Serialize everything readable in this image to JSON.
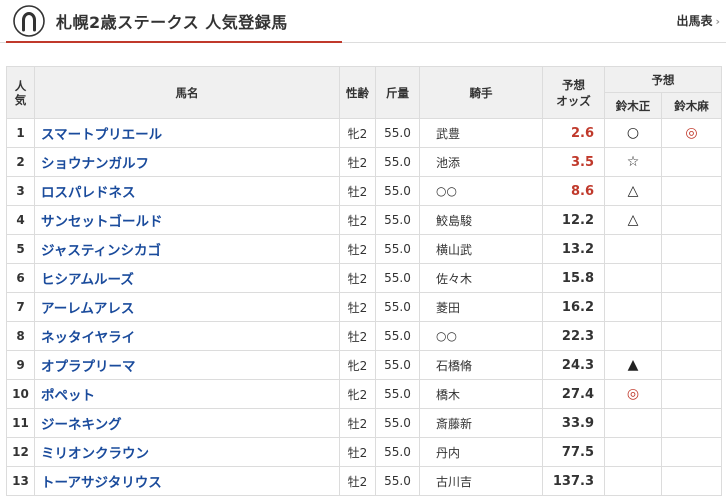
{
  "header": {
    "title": "札幌2歳ステークス 人気登録馬",
    "link_label": "出馬表",
    "link_chevron": "›"
  },
  "table": {
    "headers": {
      "rank_line1": "人",
      "rank_line2": "気",
      "horse": "馬名",
      "sexage": "性齢",
      "weight": "斤量",
      "jockey": "騎手",
      "odds_line1": "予想",
      "odds_line2": "オッズ",
      "prediction": "予想",
      "predictor1": "鈴木正",
      "predictor2": "鈴木麻"
    },
    "rows": [
      {
        "rank": "1",
        "horse": "スマートプリエール",
        "sexage": "牝2",
        "weight": "55.0",
        "jockey": "武豊",
        "odds": "2.6",
        "mark1": "○",
        "mark2": "◎"
      },
      {
        "rank": "2",
        "horse": "ショウナンガルフ",
        "sexage": "牡2",
        "weight": "55.0",
        "jockey": "池添",
        "odds": "3.5",
        "mark1": "☆",
        "mark2": ""
      },
      {
        "rank": "3",
        "horse": "ロスパレドネス",
        "sexage": "牡2",
        "weight": "55.0",
        "jockey": "○○",
        "odds": "8.6",
        "mark1": "△",
        "mark2": ""
      },
      {
        "rank": "4",
        "horse": "サンセットゴールド",
        "sexage": "牡2",
        "weight": "55.0",
        "jockey": "鮫島駿",
        "odds": "12.2",
        "mark1": "△",
        "mark2": ""
      },
      {
        "rank": "5",
        "horse": "ジャスティンシカゴ",
        "sexage": "牡2",
        "weight": "55.0",
        "jockey": "横山武",
        "odds": "13.2",
        "mark1": "",
        "mark2": ""
      },
      {
        "rank": "6",
        "horse": "ヒシアムルーズ",
        "sexage": "牡2",
        "weight": "55.0",
        "jockey": "佐々木",
        "odds": "15.8",
        "mark1": "",
        "mark2": ""
      },
      {
        "rank": "7",
        "horse": "アーレムアレス",
        "sexage": "牡2",
        "weight": "55.0",
        "jockey": "菱田",
        "odds": "16.2",
        "mark1": "",
        "mark2": ""
      },
      {
        "rank": "8",
        "horse": "ネッタイヤライ",
        "sexage": "牡2",
        "weight": "55.0",
        "jockey": "○○",
        "odds": "22.3",
        "mark1": "",
        "mark2": ""
      },
      {
        "rank": "9",
        "horse": "オプラプリーマ",
        "sexage": "牝2",
        "weight": "55.0",
        "jockey": "石橋脩",
        "odds": "24.3",
        "mark1": "▲",
        "mark2": ""
      },
      {
        "rank": "10",
        "horse": "ポペット",
        "sexage": "牝2",
        "weight": "55.0",
        "jockey": "橋木",
        "odds": "27.4",
        "mark1": "◎",
        "mark2": ""
      },
      {
        "rank": "11",
        "horse": "ジーネキング",
        "sexage": "牡2",
        "weight": "55.0",
        "jockey": "斎藤新",
        "odds": "33.9",
        "mark1": "",
        "mark2": ""
      },
      {
        "rank": "12",
        "horse": "ミリオンクラウン",
        "sexage": "牡2",
        "weight": "55.0",
        "jockey": "丹内",
        "odds": "77.5",
        "mark1": "",
        "mark2": ""
      },
      {
        "rank": "13",
        "horse": "トーアサジタリウス",
        "sexage": "牡2",
        "weight": "55.0",
        "jockey": "古川吉",
        "odds": "137.3",
        "mark1": "",
        "mark2": ""
      }
    ]
  },
  "colors": {
    "accent_red": "#c0392b",
    "link_blue": "#1a4b9c",
    "header_bg": "#f0f0f0"
  },
  "icons": {
    "logo": "horseshoe-icon"
  }
}
